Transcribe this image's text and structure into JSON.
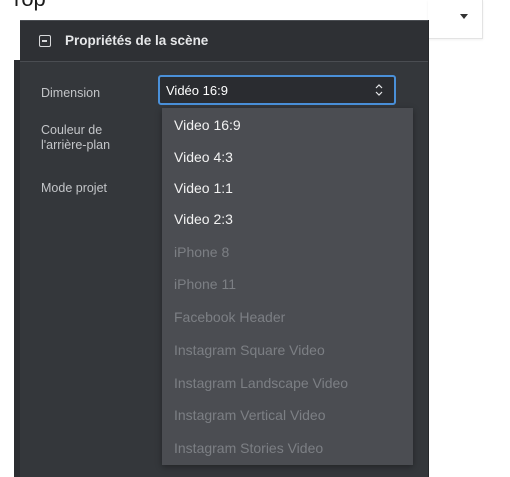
{
  "crop_text": "rop",
  "panel": {
    "title": "Propriétés de la scène",
    "labels": {
      "dimension": "Dimension",
      "background_color_line1": "Couleur de",
      "background_color_line2": "l'arrière-plan",
      "project_mode": "Mode projet"
    }
  },
  "select": {
    "value": "Vidéo 16:9"
  },
  "dropdown": {
    "options": [
      {
        "label": "Video 16:9",
        "enabled": true
      },
      {
        "label": "Video 4:3",
        "enabled": true
      },
      {
        "label": "Video 1:1",
        "enabled": true
      },
      {
        "label": "Video 2:3",
        "enabled": true
      },
      {
        "label": "iPhone 8",
        "enabled": false
      },
      {
        "label": "iPhone 11",
        "enabled": false
      },
      {
        "label": "Facebook Header",
        "enabled": false
      },
      {
        "label": "Instagram Square Video",
        "enabled": false
      },
      {
        "label": "Instagram Landscape Video",
        "enabled": false
      },
      {
        "label": "Instagram Vertical Video",
        "enabled": false
      },
      {
        "label": "Instagram Stories Video",
        "enabled": false
      }
    ]
  },
  "colors": {
    "panel_bg": "#34373b",
    "select_border": "#4a90d9",
    "dropdown_bg": "#4b4d52"
  },
  "icons": {
    "collapse": "collapse-icon",
    "select_arrows": "select-arrows-icon",
    "toolbar_caret": "chevron-down-icon"
  }
}
